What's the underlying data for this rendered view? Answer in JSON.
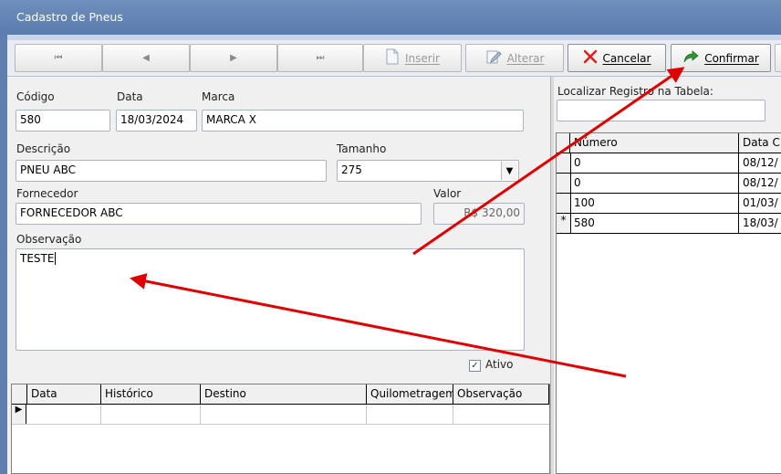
{
  "window": {
    "title": "Cadastro de Pneus"
  },
  "toolbar": {
    "first_icon": "⏮",
    "prev_icon": "◀",
    "next_icon": "▶",
    "last_icon": "⏭",
    "inserir": "Inserir",
    "alterar": "Alterar",
    "cancelar": "Cancelar",
    "confirmar": "Confirmar"
  },
  "form": {
    "codigo_label": "Código",
    "codigo_value": "580",
    "data_label": "Data",
    "data_value": "18/03/2024",
    "marca_label": "Marca",
    "marca_value": "MARCA X",
    "descricao_label": "Descrição",
    "descricao_value": "PNEU ABC",
    "tamanho_label": "Tamanho",
    "tamanho_value": "275",
    "fornecedor_label": "Fornecedor",
    "fornecedor_value": "FORNECEDOR ABC",
    "valor_label": "Valor",
    "valor_value": "R$ 320,00",
    "observacao_label": "Observação",
    "observacao_value": "TESTE",
    "ativo_label": "Ativo",
    "ativo_checked": true
  },
  "history_grid": {
    "columns": [
      "Data",
      "Histórico",
      "Destino",
      "Quilometragem",
      "Observação"
    ]
  },
  "side": {
    "search_label": "Localizar Registro na Tabela:",
    "search_value": "",
    "columns": [
      "Número",
      "Data C"
    ],
    "rows": [
      {
        "numero": "0",
        "data": "08/12/"
      },
      {
        "numero": "0",
        "data": "08/12/"
      },
      {
        "numero": "100",
        "data": "01/03/"
      },
      {
        "numero": "580",
        "data": "18/03/"
      }
    ]
  },
  "colors": {
    "titlebar": "#5f7fb0",
    "arrow": "#e00000"
  }
}
